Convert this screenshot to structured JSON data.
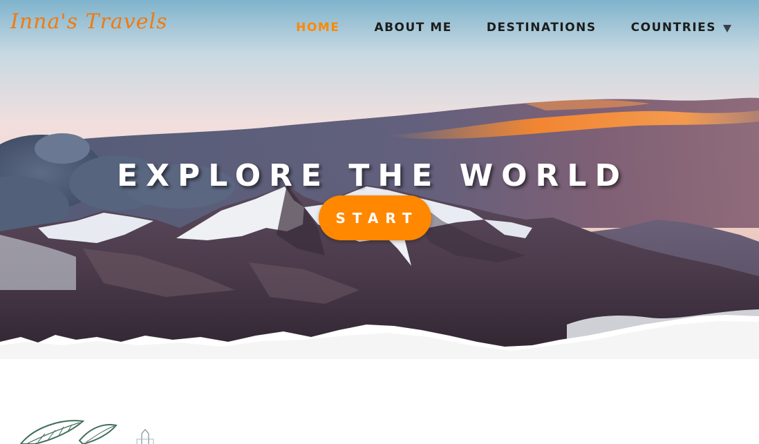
{
  "brand": {
    "logo_text": "Inna's Travels",
    "accent_color": "#ff8800",
    "logo_color": "#f07a10"
  },
  "nav": {
    "items": [
      {
        "label": "HOME",
        "active": true
      },
      {
        "label": "ABOUT ME",
        "active": false
      },
      {
        "label": "DESTINATIONS",
        "active": false
      },
      {
        "label": "COUNTRIES",
        "active": false,
        "has_dropdown": true
      }
    ],
    "dropdown_icon": "caret-down-icon"
  },
  "hero": {
    "headline": "EXPLORE THE WORLD",
    "cta_label": "START",
    "background": "mountain-range-at-sunset"
  },
  "decoration": {
    "icon": "leaf-sketch-icon"
  }
}
